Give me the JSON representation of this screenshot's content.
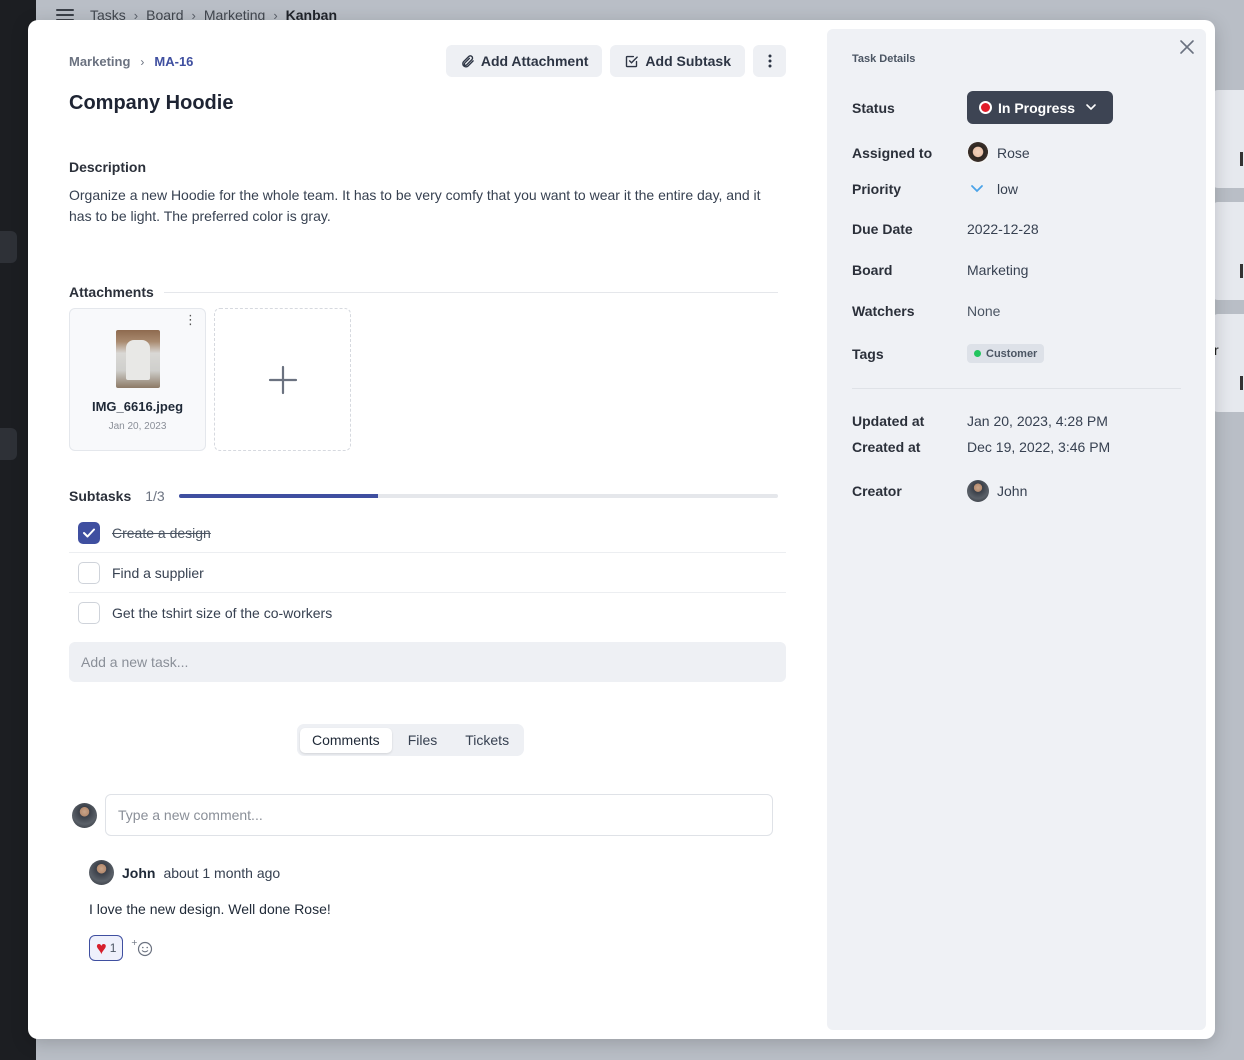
{
  "background": {
    "breadcrumb": [
      "Tasks",
      "Board",
      "Marketing"
    ],
    "breadcrumb_current": "Kanban",
    "partial_letter": "r"
  },
  "header": {
    "project": "Marketing",
    "task_id": "MA-16",
    "add_attachment_label": "Add Attachment",
    "add_subtask_label": "Add Subtask"
  },
  "task": {
    "title": "Company Hoodie",
    "description_heading": "Description",
    "description": "Organize a new Hoodie for the whole team. It has to be very comfy that you want to wear it the entire day, and it has to be light. The preferred color is gray."
  },
  "attachments": {
    "heading": "Attachments",
    "files": [
      {
        "name": "IMG_6616.jpeg",
        "date": "Jan 20, 2023"
      }
    ]
  },
  "subtasks": {
    "heading": "Subtasks",
    "count": "1/3",
    "progress": 0.333,
    "items": [
      {
        "label": "Create a design",
        "done": true
      },
      {
        "label": "Find a supplier",
        "done": false
      },
      {
        "label": "Get the tshirt size of the co-workers",
        "done": false
      }
    ],
    "add_placeholder": "Add a new task..."
  },
  "tabs": [
    {
      "label": "Comments",
      "active": true
    },
    {
      "label": "Files",
      "active": false
    },
    {
      "label": "Tickets",
      "active": false
    }
  ],
  "comment_input": {
    "placeholder": "Type a new comment..."
  },
  "comments": [
    {
      "author": "John",
      "time": "about 1 month ago",
      "body": "I love the new design. Well done Rose!",
      "reactions": [
        {
          "emoji": "heart",
          "count": "1"
        }
      ]
    }
  ],
  "details": {
    "heading": "Task Details",
    "status_label": "Status",
    "status_value": "In Progress",
    "status_color": "#e11d2a",
    "assigned_label": "Assigned to",
    "assigned_value": "Rose",
    "priority_label": "Priority",
    "priority_value": "low",
    "due_label": "Due Date",
    "due_value": "2022-12-28",
    "board_label": "Board",
    "board_value": "Marketing",
    "watchers_label": "Watchers",
    "watchers_value": "None",
    "tags_label": "Tags",
    "tag_value": "Customer",
    "updated_label": "Updated at",
    "updated_value": "Jan 20, 2023, 4:28 PM",
    "created_label": "Created at",
    "created_value": "Dec 19, 2022, 3:46 PM",
    "creator_label": "Creator",
    "creator_value": "John"
  },
  "colors": {
    "accent": "#3f4fa0",
    "status_button": "#3d4453",
    "panel_bg": "#eff1f5"
  }
}
